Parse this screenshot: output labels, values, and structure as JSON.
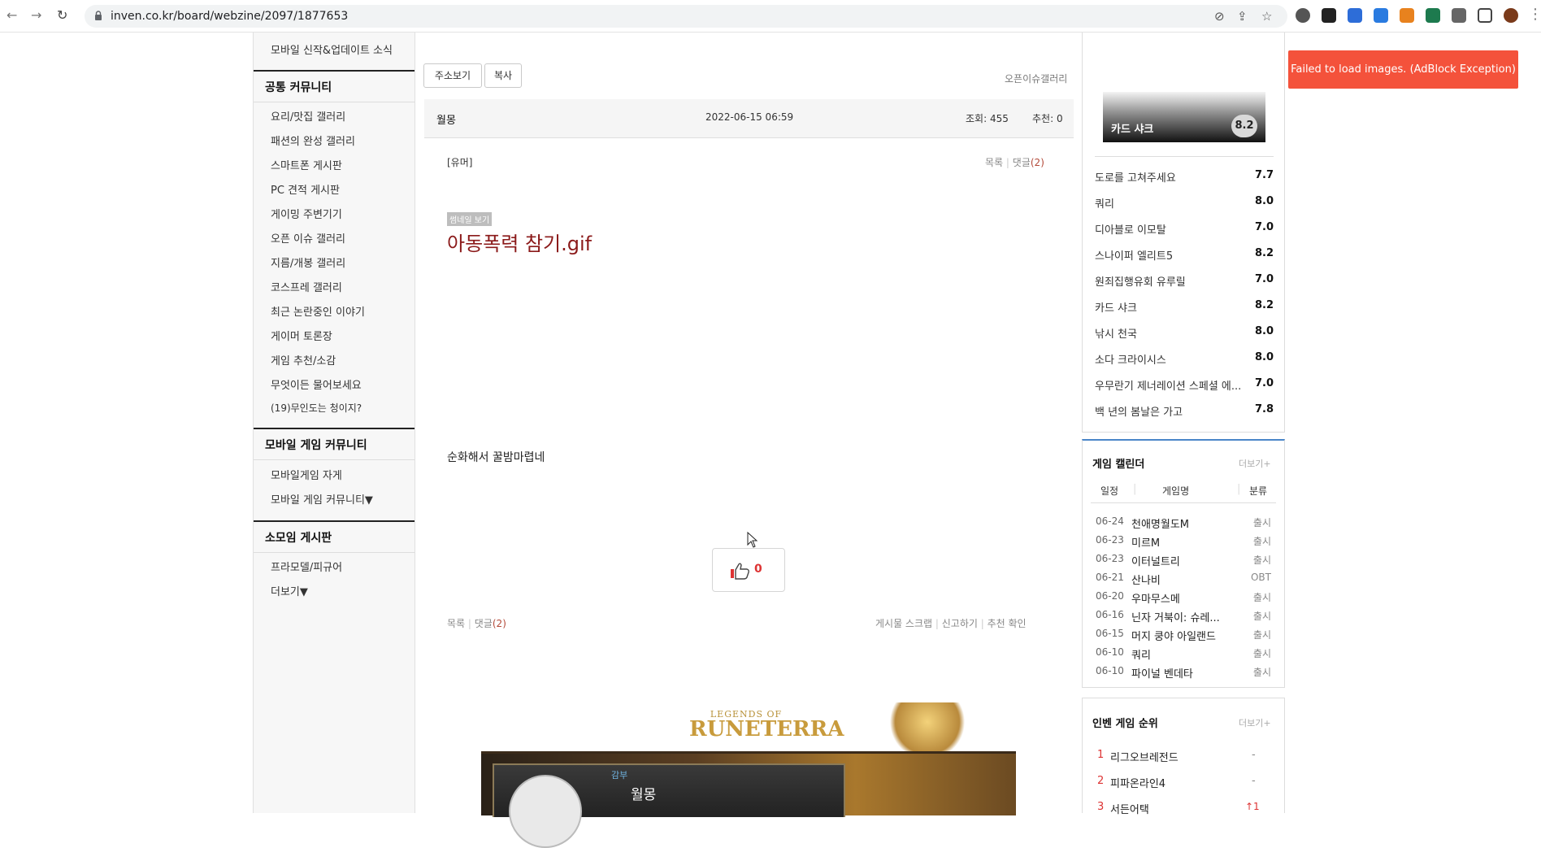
{
  "browser": {
    "url": "inven.co.kr/board/webzine/2097/1877653",
    "back_icon": "←",
    "forward_icon": "→",
    "reload_icon": "↻"
  },
  "sidebar": {
    "top_item": "모바일 신작&업데이트 소식",
    "sections": [
      {
        "title": "공통 커뮤니티",
        "items": [
          "요리/맛집 갤러리",
          "패션의 완성 갤러리",
          "스마트폰 게시판",
          "PC 견적 게시판",
          "게이밍 주변기기",
          "오픈 이슈 갤러리",
          "지름/개봉 갤러리",
          "코스프레 갤러리",
          "최근 논란중인 이야기",
          "게이머 토론장",
          "게임 추천/소감",
          "무엇이든 물어보세요",
          "(19)무인도는 청이지?"
        ]
      },
      {
        "title": "모바일 게임 커뮤니티",
        "items": [
          "모바일게임 자게",
          "모바일 게임 커뮤니티▼"
        ]
      },
      {
        "title": "소모임 게시판",
        "items": [
          "프라모델/피규어",
          "더보기▼"
        ]
      }
    ]
  },
  "article": {
    "btn_url": "주소보기",
    "btn_copy": "복사",
    "board_name": "오픈이슈갤러리",
    "author": "월몽",
    "date": "2022-06-15 06:59",
    "views": "조회: 455",
    "recommends": "추천: 0",
    "category": "[유머]",
    "list_link": "목록",
    "comments_label": "댓글",
    "comments_count": "(2)",
    "thumb_label": "썸네일 보기",
    "title": "아동폭력 참기.gif",
    "body": "순화해서 꿀밤마렵네",
    "like_count": "0",
    "scrap": "게시물 스크랩",
    "report": "신고하기",
    "rec_check": "추천 확인",
    "banner_logo_1": "LEGENDS OF",
    "banner_logo_2": "RUNETERRA",
    "banner_small": "감부",
    "banner_name": "월몽"
  },
  "scores": {
    "featured_name": "카드 샤크",
    "featured_score": "8.2",
    "rows": [
      {
        "name": "도로를 고쳐주세요",
        "score": "7.7"
      },
      {
        "name": "쿼리",
        "score": "8.0"
      },
      {
        "name": "디아블로 이모탈",
        "score": "7.0"
      },
      {
        "name": "스나이퍼 엘리트5",
        "score": "8.2"
      },
      {
        "name": "원죄집행유회 유루릴",
        "score": "7.0"
      },
      {
        "name": "카드 샤크",
        "score": "8.2"
      },
      {
        "name": "낚시 천국",
        "score": "8.0"
      },
      {
        "name": "소다 크라이시스",
        "score": "8.0"
      },
      {
        "name": "우무란기 제너레이션 스페셜 에...",
        "score": "7.0"
      },
      {
        "name": "백 년의 봄날은 가고",
        "score": "7.8"
      }
    ]
  },
  "calendar": {
    "title": "게임 캘린더",
    "more": "더보기+",
    "col_date": "일정",
    "col_name": "게임명",
    "col_type": "분류",
    "rows": [
      {
        "date": "06-24",
        "name": "천애명월도M",
        "type": "출시"
      },
      {
        "date": "06-23",
        "name": "미르M",
        "type": "출시"
      },
      {
        "date": "06-23",
        "name": "이터널트리",
        "type": "출시"
      },
      {
        "date": "06-21",
        "name": "산나비",
        "type": "OBT"
      },
      {
        "date": "06-20",
        "name": "우마무스메",
        "type": "출시"
      },
      {
        "date": "06-16",
        "name": "닌자 거북이: 슈레...",
        "type": "출시"
      },
      {
        "date": "06-15",
        "name": "머지 쿵야 아일랜드",
        "type": "출시"
      },
      {
        "date": "06-10",
        "name": "쿼리",
        "type": "출시"
      },
      {
        "date": "06-10",
        "name": "파이널 벤데타",
        "type": "출시"
      }
    ]
  },
  "ranking": {
    "title": "인벤 게임 순위",
    "more": "더보기+",
    "rows": [
      {
        "rank": "1",
        "name": "리그오브레전드",
        "change": "-"
      },
      {
        "rank": "2",
        "name": "피파온라인4",
        "change": "-"
      },
      {
        "rank": "3",
        "name": "서든어택",
        "change": "↑1"
      }
    ]
  },
  "toast": "Failed to load images. (AdBlock Exception)",
  "colors": {
    "accent_red": "#8b1a1a",
    "toast": "#f4523b",
    "link_red": "#b34a3a"
  }
}
